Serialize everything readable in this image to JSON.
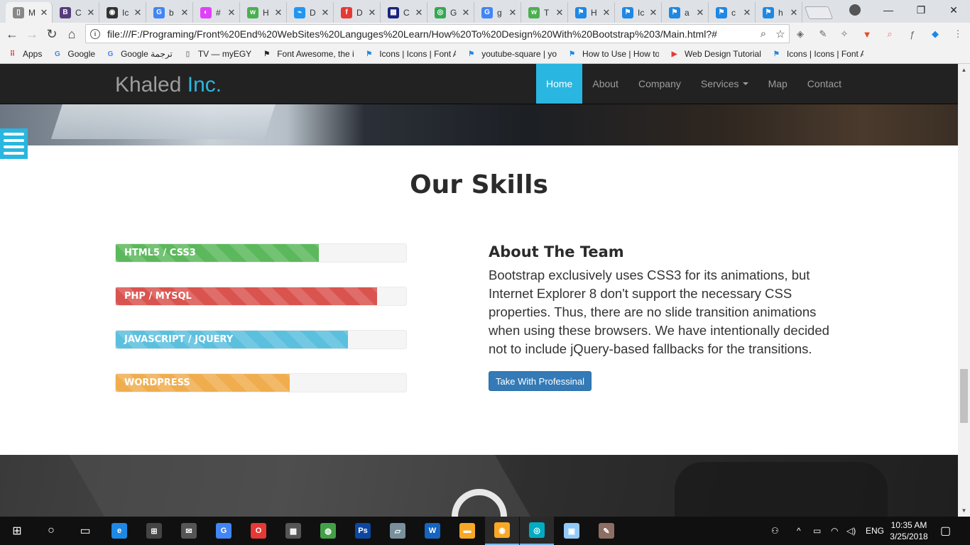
{
  "browser": {
    "tabs": [
      {
        "title": "M",
        "favicon": "page-icon",
        "color": "#888888",
        "glyph": "▯",
        "active": true
      },
      {
        "title": "C",
        "favicon": "bootstrap-icon",
        "color": "#563d7c",
        "glyph": "B"
      },
      {
        "title": "Ic",
        "favicon": "github-icon",
        "color": "#333333",
        "glyph": "◉"
      },
      {
        "title": "b",
        "favicon": "google-icon",
        "color": "#4285f4",
        "glyph": "G"
      },
      {
        "title": "#",
        "favicon": "color-wheel-icon",
        "color": "#e040fb",
        "glyph": "◐"
      },
      {
        "title": "H",
        "favicon": "w3schools-icon",
        "color": "#4caf50",
        "glyph": "w"
      },
      {
        "title": "D",
        "favicon": "link-icon",
        "color": "#2196f3",
        "glyph": "⌁"
      },
      {
        "title": "D",
        "favicon": "facebook-icon",
        "color": "#e53935",
        "glyph": "f"
      },
      {
        "title": "C",
        "favicon": "dans-tools-icon",
        "color": "#1a237e",
        "glyph": "▦"
      },
      {
        "title": "G",
        "favicon": "chrome-icon",
        "color": "#34a853",
        "glyph": "◎"
      },
      {
        "title": "g",
        "favicon": "google-icon",
        "color": "#4285f4",
        "glyph": "G"
      },
      {
        "title": "T",
        "favicon": "w3schools-icon",
        "color": "#4caf50",
        "glyph": "w"
      },
      {
        "title": "H",
        "favicon": "flag-icon",
        "color": "#1e88e5",
        "glyph": "⚑"
      },
      {
        "title": "Ic",
        "favicon": "flag-icon",
        "color": "#1e88e5",
        "glyph": "⚑"
      },
      {
        "title": "a",
        "favicon": "flag-icon",
        "color": "#1e88e5",
        "glyph": "⚑"
      },
      {
        "title": "c",
        "favicon": "flag-icon",
        "color": "#1e88e5",
        "glyph": "⚑"
      },
      {
        "title": "h",
        "favicon": "flag-icon",
        "color": "#1e88e5",
        "glyph": "⚑"
      }
    ],
    "url": "file:///F:/Programing/Front%20End%20WebSites%20Languges%20Learn/How%20To%20Design%20With%20Bootstrap%203/Main.html?#",
    "bookmarks": [
      {
        "label": "Apps",
        "icon": "apps-grid-icon",
        "color": "#e53935",
        "glyph": "⠿"
      },
      {
        "label": "Google",
        "icon": "google-icon",
        "color": "#4285f4",
        "glyph": "G"
      },
      {
        "label": "Google ترجمة",
        "icon": "translate-icon",
        "color": "#4285f4",
        "glyph": "G"
      },
      {
        "label": "TV — myEGY",
        "icon": "page-icon",
        "color": "#888888",
        "glyph": "▯"
      },
      {
        "label": "Font Awesome, the i",
        "icon": "font-awesome-icon",
        "color": "#222222",
        "glyph": "⚑"
      },
      {
        "label": "Icons | Icons | Font A",
        "icon": "flag-icon",
        "color": "#1e88e5",
        "glyph": "⚑"
      },
      {
        "label": "youtube-square | yo",
        "icon": "flag-icon",
        "color": "#1e88e5",
        "glyph": "⚑"
      },
      {
        "label": "How to Use | How to",
        "icon": "flag-icon",
        "color": "#1e88e5",
        "glyph": "⚑"
      },
      {
        "label": "Web Design Tutorial",
        "icon": "youtube-icon",
        "color": "#e53935",
        "glyph": "▶"
      },
      {
        "label": "Icons | Icons | Font A",
        "icon": "flag-icon",
        "color": "#1e88e5",
        "glyph": "⚑"
      }
    ]
  },
  "site": {
    "brand": "Khaled",
    "brand_accent": "Inc.",
    "accent_color": "#29b6e0",
    "nav": [
      {
        "label": "Home",
        "active": true
      },
      {
        "label": "About"
      },
      {
        "label": "Company"
      },
      {
        "label": "Services",
        "dropdown": true
      },
      {
        "label": "Map"
      },
      {
        "label": "Contact"
      }
    ],
    "skills_title": "Our Skills",
    "skills": [
      {
        "label": "HTML5 / CSS3",
        "percent": 70,
        "color": "#5cb85c"
      },
      {
        "label": "PHP / MYSQL",
        "percent": 90,
        "color": "#d9534f"
      },
      {
        "label": "JAVASCRIPT / JQUERY",
        "percent": 80,
        "color": "#5bc0de"
      },
      {
        "label": "WORDPRESS",
        "percent": 60,
        "color": "#f0ad4e"
      }
    ],
    "team_title": "About The Team",
    "team_text": "Bootstrap exclusively uses CSS3 for its animations, but Internet Explorer 8 don't support the necessary CSS properties. Thus, there are no slide transition animations when using these browsers. We have intentionally decided not to include jQuery-based fallbacks for the transitions.",
    "team_button": "Take With Professinal"
  },
  "taskbar": {
    "apps": [
      {
        "icon": "edge-icon",
        "glyph": "e",
        "color": "#1e88e5"
      },
      {
        "icon": "store-icon",
        "glyph": "⊞",
        "color": "#444444"
      },
      {
        "icon": "mail-icon",
        "glyph": "✉",
        "color": "#555555"
      },
      {
        "icon": "chrome-icon",
        "glyph": "G",
        "color": "#4285f4"
      },
      {
        "icon": "opera-icon",
        "glyph": "O",
        "color": "#e53935"
      },
      {
        "icon": "calculator-icon",
        "glyph": "▦",
        "color": "#555555"
      },
      {
        "icon": "globe-icon",
        "glyph": "◍",
        "color": "#43a047"
      },
      {
        "icon": "photoshop-icon",
        "glyph": "Ps",
        "color": "#0d47a1"
      },
      {
        "icon": "notes-icon",
        "glyph": "▱",
        "color": "#78909c"
      },
      {
        "icon": "word-icon",
        "glyph": "W",
        "color": "#1565c0"
      },
      {
        "icon": "folder-icon",
        "glyph": "▬",
        "color": "#f9a825"
      },
      {
        "icon": "app-orange-icon",
        "glyph": "◉",
        "color": "#f9a825"
      },
      {
        "icon": "media-player-icon",
        "glyph": "◎",
        "color": "#00acc1"
      },
      {
        "icon": "window-app-icon",
        "glyph": "▣",
        "color": "#90caf9"
      },
      {
        "icon": "paint-icon",
        "glyph": "✎",
        "color": "#8d6e63"
      }
    ],
    "language": "ENG",
    "time": "10:35 AM",
    "date": "3/25/2018"
  }
}
